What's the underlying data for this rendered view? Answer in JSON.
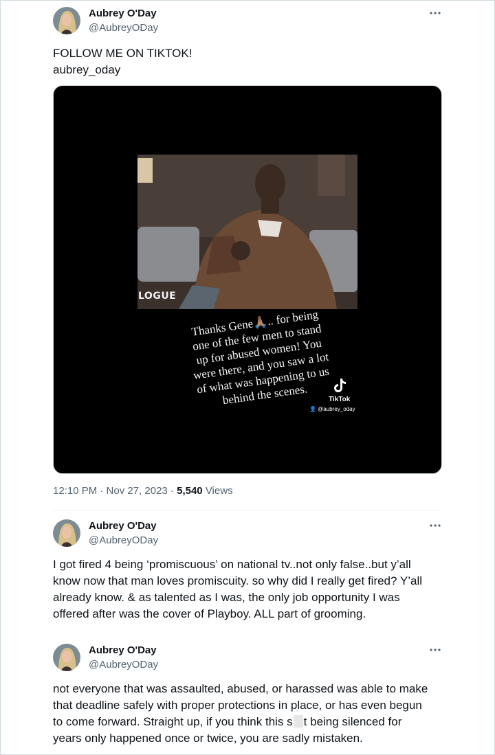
{
  "tweets": [
    {
      "author": {
        "name": "Aubrey O'Day",
        "handle": "@AubreyODay"
      },
      "more_icon": "more-horizontal-icon",
      "text_lines": [
        "FOLLOW ME ON TIKTOK!",
        "aubrey_oday"
      ],
      "media": {
        "clip_label": "LOGUE",
        "caption_lines": [
          "Thanks Gene🙏🏽.. for being",
          "one of the few men to stand",
          "up for abused women! You",
          "were there, and you saw a lot",
          "of what was happening to us",
          "behind the scenes."
        ],
        "tiktok_label": "TikTok",
        "tiktok_user": "👤 @aubrey_oday"
      },
      "meta": {
        "timestamp": "12:10 PM · Nov 27, 2023 · ",
        "views_count": "5,540",
        "views_label": " Views"
      }
    },
    {
      "author": {
        "name": "Aubrey O'Day",
        "handle": "@AubreyODay"
      },
      "more_icon": "more-horizontal-icon",
      "text_lines": [
        "I got fired 4 being ‘promiscuous’ on national tv..not only false..but y’all",
        "know now that man loves promiscuity. so why did I really get fired? Y’all",
        "already know. & as talented as I was, the only job opportunity I was",
        "offered after was the cover of Playboy. ALL part of grooming."
      ]
    },
    {
      "author": {
        "name": "Aubrey O'Day",
        "handle": "@AubreyODay"
      },
      "more_icon": "more-horizontal-icon",
      "text_lines": [
        "not everyone that was assaulted, abused, or harassed was able to make",
        "that deadline safely with proper protections in place, or has even begun",
        "to come forward. Straight up, if you think this s",
        "t being silenced for",
        "years only happened once or twice, you are sadly mistaken."
      ]
    }
  ]
}
